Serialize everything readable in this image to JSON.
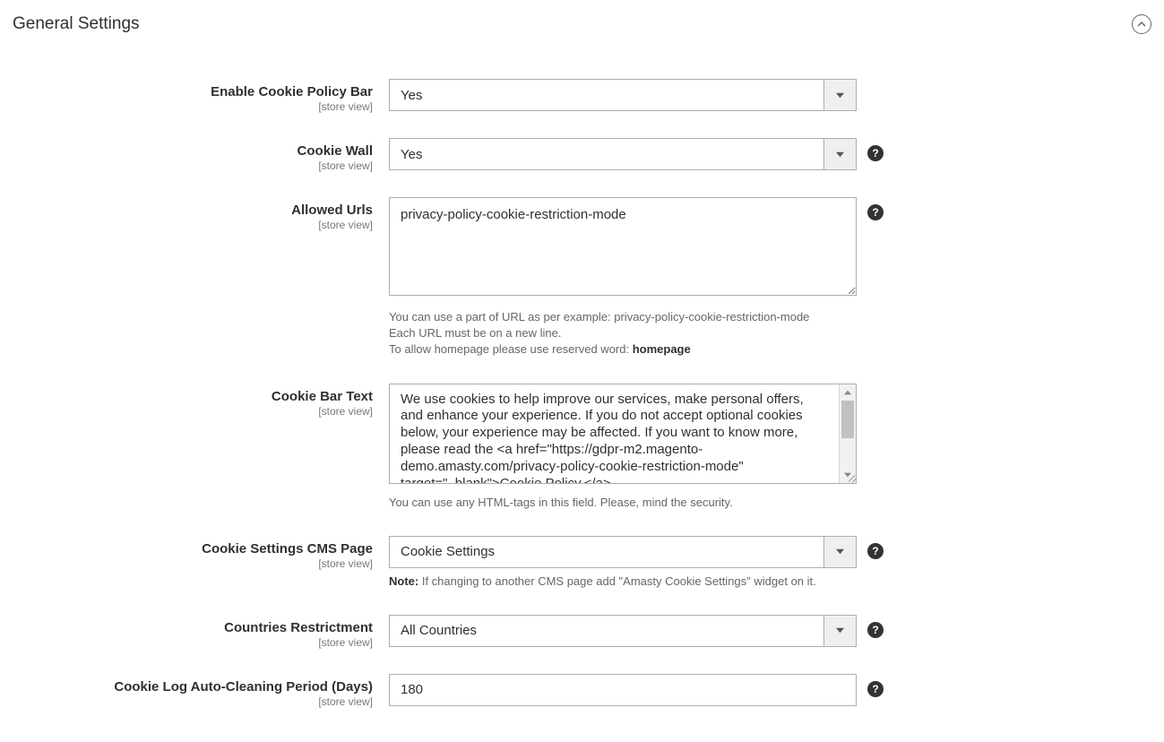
{
  "section_title": "General Settings",
  "scope_label": "[store view]",
  "fields": {
    "enable_bar": {
      "label": "Enable Cookie Policy Bar",
      "value": "Yes"
    },
    "cookie_wall": {
      "label": "Cookie Wall",
      "value": "Yes"
    },
    "allowed_urls": {
      "label": "Allowed Urls",
      "value": "privacy-policy-cookie-restriction-mode",
      "hint_line1": "You can use a part of URL as per example: privacy-policy-cookie-restriction-mode",
      "hint_line2": "Each URL must be on a new line.",
      "hint_line3a": "To allow homepage please use reserved word: ",
      "hint_line3b": "homepage"
    },
    "bar_text": {
      "label": "Cookie Bar Text",
      "value": "We use cookies to help improve our services, make personal offers, and enhance your experience. If you do not accept optional cookies below, your experience may be affected. If you want to know more, please read the <a href=\"https://gdpr-m2.magento-demo.amasty.com/privacy-policy-cookie-restriction-mode\" target=\"_blank\">Cookie Policy.</a>",
      "hint": "You can use any HTML-tags in this field. Please, mind the security."
    },
    "cms_page": {
      "label": "Cookie Settings CMS Page",
      "value": "Cookie Settings",
      "hint_bold": "Note:",
      "hint_rest": " If changing to another CMS page add \"Amasty Cookie Settings\" widget on it."
    },
    "countries": {
      "label": "Countries Restrictment",
      "value": "All Countries"
    },
    "log_days": {
      "label": "Cookie Log Auto-Cleaning Period (Days)",
      "value": "180"
    }
  }
}
